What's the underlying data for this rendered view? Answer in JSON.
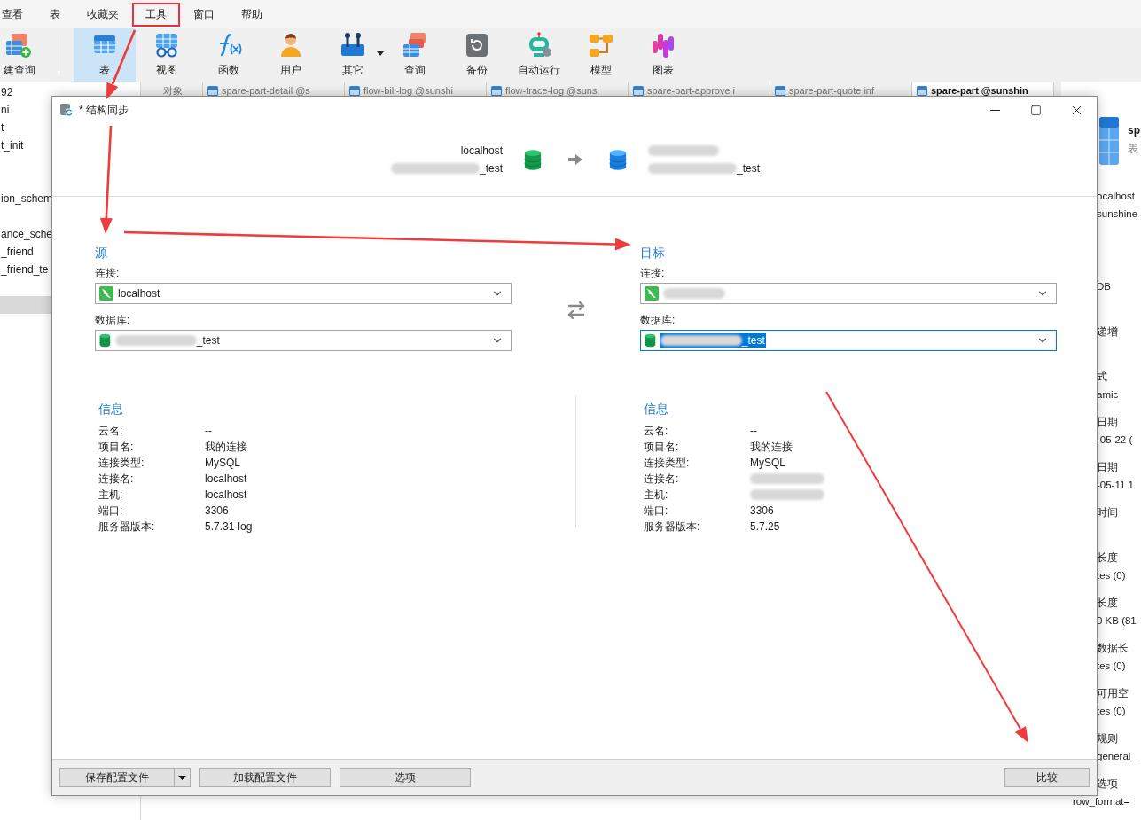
{
  "menu_bar": [
    {
      "label": "查看",
      "highlighted": false
    },
    {
      "label": "表",
      "highlighted": false
    },
    {
      "label": "收藏夹",
      "highlighted": false
    },
    {
      "label": "工具",
      "highlighted": true
    },
    {
      "label": "窗口",
      "highlighted": false
    },
    {
      "label": "帮助",
      "highlighted": false
    }
  ],
  "toolbar": [
    {
      "label": "建查询",
      "selected": false,
      "dropdown": false
    },
    {
      "label": "表",
      "selected": true,
      "dropdown": false
    },
    {
      "label": "视图",
      "selected": false,
      "dropdown": false
    },
    {
      "label": "函数",
      "selected": false,
      "dropdown": false
    },
    {
      "label": "用户",
      "selected": false,
      "dropdown": false
    },
    {
      "label": "其它",
      "selected": false,
      "dropdown": true
    },
    {
      "label": "查询",
      "selected": false,
      "dropdown": false
    },
    {
      "label": "备份",
      "selected": false,
      "dropdown": false
    },
    {
      "label": "自动运行",
      "selected": false,
      "dropdown": false
    },
    {
      "label": "模型",
      "selected": false,
      "dropdown": false
    },
    {
      "label": "图表",
      "selected": false,
      "dropdown": false
    }
  ],
  "sidebar": {
    "items": [
      {
        "label": "92",
        "selected": false
      },
      {
        "label": "ni",
        "selected": false
      },
      {
        "label": "t",
        "selected": false
      },
      {
        "label": "t_init",
        "selected": false
      },
      {
        "selected": false
      },
      {
        "selected": false
      },
      {
        "label": "ion_schem",
        "selected": false
      },
      {
        "selected": false
      },
      {
        "label": "ance_sche",
        "selected": false
      },
      {
        "label": "_friend",
        "selected": false
      },
      {
        "label": "_friend_te",
        "selected": false
      },
      {
        "selected": false
      },
      {
        "selected": true
      }
    ]
  },
  "tabs": [
    {
      "label": "对象",
      "selected": false
    },
    {
      "label": "spare-part-detail @s",
      "selected": false
    },
    {
      "label": "flow-bill-log @sunshi",
      "selected": false
    },
    {
      "label": "flow-trace-log @suns",
      "selected": false
    },
    {
      "label": "spare-part-approve i",
      "selected": false
    },
    {
      "label": "spare-part-quote inf",
      "selected": false
    },
    {
      "label": "spare-part @sunshin",
      "selected": true
    }
  ],
  "info_panel": {
    "title": "sp",
    "subtitle": "表",
    "groups": [
      {
        "label": "ocalhost",
        "value": "sunshine"
      },
      {
        "value": "DB"
      },
      {
        "label": "递增"
      },
      {
        "label": "式",
        "value": "amic"
      },
      {
        "label": "日期",
        "value": "-05-22 ("
      },
      {
        "label": "日期",
        "value": "-05-11 1"
      },
      {
        "label": "时间"
      },
      {
        "label": "长度",
        "value": "tes (0)"
      },
      {
        "label": "长度",
        "value": "0 KB (81"
      },
      {
        "label": "数据长",
        "value": "tes (0)"
      },
      {
        "label": "可用空",
        "value": "tes (0)"
      },
      {
        "label": "规则",
        "value": "general_"
      },
      {
        "label": "选项",
        "value": "row_format="
      }
    ]
  },
  "dialog": {
    "title": "* 结构同步",
    "summary": [
      {
        "host": "localhost",
        "database": "_test",
        "database_redacted": true
      },
      {
        "host_redacted": true,
        "database": "_test",
        "database_redacted": true
      }
    ],
    "panels": [
      {
        "heading": "源",
        "connection_label": "连接:",
        "connection": {
          "value": "localhost",
          "focused": false,
          "text_selected": false
        },
        "database_label": "数据库:",
        "database": {
          "value": "_test",
          "redacted": true,
          "focused": false,
          "text_selected": false
        }
      },
      {
        "heading": "目标",
        "connection_label": "连接:",
        "connection": {
          "redacted": true,
          "focused": false,
          "text_selected": false
        },
        "database_label": "数据库:",
        "database": {
          "value": "_test",
          "redacted": true,
          "focused": true,
          "text_selected": true
        }
      }
    ],
    "info": [
      {
        "heading": "信息",
        "rows": [
          {
            "label": "云名:",
            "value": "--"
          },
          {
            "label": "项目名:",
            "value": "我的连接"
          },
          {
            "label": "连接类型:",
            "value": "MySQL"
          },
          {
            "label": "连接名:",
            "value": "localhost"
          },
          {
            "label": "主机:",
            "value": "localhost"
          },
          {
            "label": "端口:",
            "value": "3306"
          },
          {
            "label": "服务器版本:",
            "value": "5.7.31-log"
          }
        ]
      },
      {
        "heading": "信息",
        "rows": [
          {
            "label": "云名:",
            "value": "--"
          },
          {
            "label": "项目名:",
            "value": "我的连接"
          },
          {
            "label": "连接类型:",
            "value": "MySQL"
          },
          {
            "label": "连接名:",
            "redacted": true
          },
          {
            "label": "主机:",
            "redacted": true
          },
          {
            "label": "端口:",
            "value": "3306"
          },
          {
            "label": "服务器版本:",
            "value": "5.7.25"
          }
        ]
      }
    ],
    "buttons": [
      {
        "label": "保存配置文件",
        "split": true
      },
      {
        "label": "加载配置文件",
        "split": false
      },
      {
        "label": "选项",
        "split": false
      },
      {
        "label": "比较",
        "split": false
      }
    ]
  }
}
